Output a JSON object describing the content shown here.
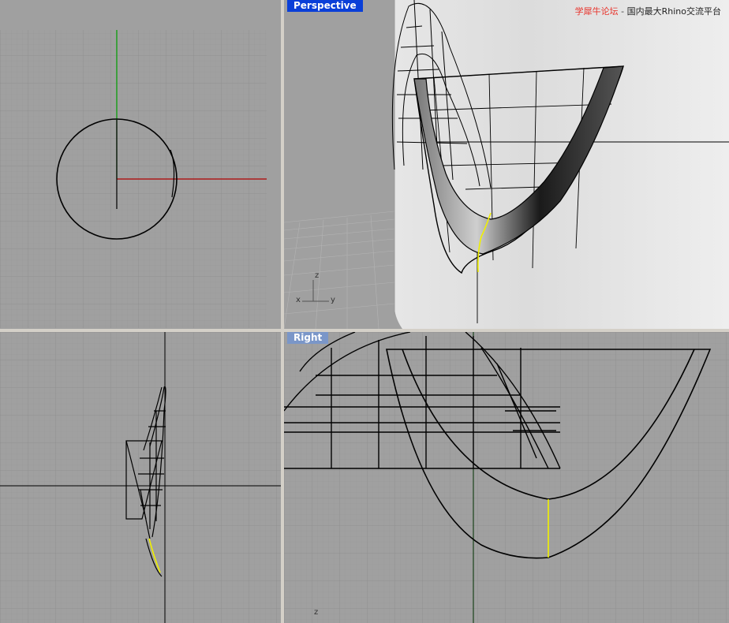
{
  "viewports": {
    "top": {
      "label": ""
    },
    "perspective": {
      "label": "Perspective"
    },
    "front": {
      "label": ""
    },
    "right": {
      "label": "Right"
    }
  },
  "watermark": {
    "brand": "学犀牛论坛",
    "separator": "-",
    "tagline": "国内最大Rhino交流平台"
  },
  "axis_icon": {
    "x": "x",
    "y": "y",
    "z": "z"
  },
  "right_axis_label": "z",
  "colors": {
    "viewport_bg": "#a0a0a0",
    "grid_minor": "#969696",
    "grid_major": "#8a8a8a",
    "x_axis": "#b00000",
    "y_axis": "#00a000",
    "selected_curve": "#f0f000",
    "active_label": "#0a3fd8",
    "inactive_label": "#7a96c8",
    "divider": "#d4d0c8"
  }
}
